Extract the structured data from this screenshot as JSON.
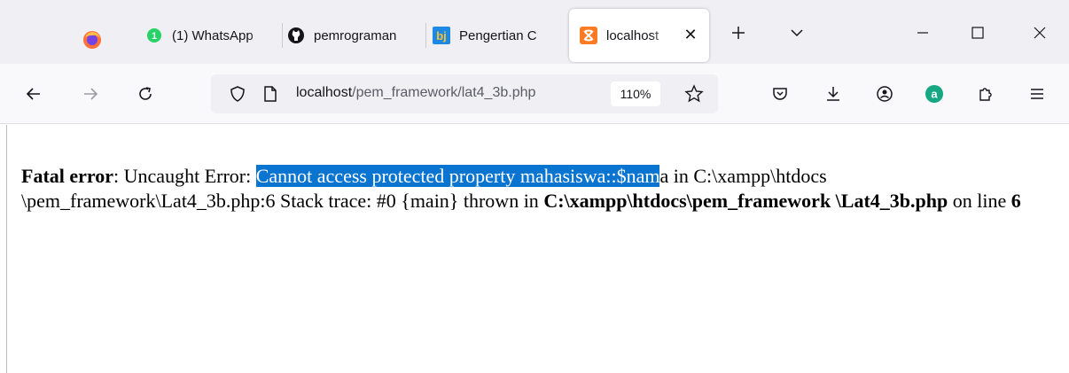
{
  "tabs": [
    {
      "label": "(1) WhatsApp",
      "icon": "whatsapp-icon",
      "active": false
    },
    {
      "label": "pemrograman",
      "icon": "github-icon",
      "active": false
    },
    {
      "label": "Pengertian C",
      "icon": "bj-site-icon",
      "active": false
    },
    {
      "label": "localhost",
      "icon": "xampp-icon",
      "active": true
    }
  ],
  "tab_close": "✕",
  "url": {
    "host": "localhost",
    "path": "/pem_framework/lat4_3b.php"
  },
  "zoom": "110%",
  "error": {
    "prefix": "Fatal error",
    "colon": ": Uncaught Error: ",
    "selected": "Cannot access protected property mahasiswa::$nam",
    "after_sel": "a in C:\\xampp\\htdocs \\pem_framework\\Lat4_3b.php:6 Stack trace: #0 {main} thrown in ",
    "file": "C:\\xampp\\htdocs\\pem_framework \\Lat4_3b.php",
    "on_line": " on line ",
    "line": "6"
  },
  "colors": {
    "selection": "#0a74d1",
    "tabstrip": "#f0f0f4",
    "navbar": "#f9f9fb",
    "whatsapp": "#25d366",
    "bj_blue": "#1e88e5",
    "xampp_orange": "#fb7a24",
    "profile_teal": "#17a883"
  }
}
